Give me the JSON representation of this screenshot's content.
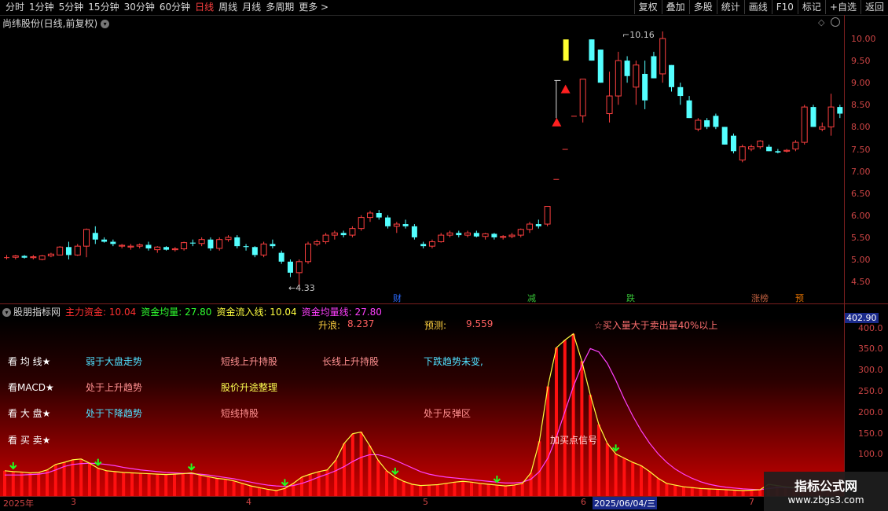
{
  "toolbar": {
    "periods": [
      "分时",
      "1分钟",
      "5分钟",
      "15分钟",
      "30分钟",
      "60分钟",
      "日线",
      "周线",
      "月线",
      "多周期",
      "更多 >"
    ],
    "active_period": "日线",
    "buttons": [
      "复权",
      "叠加",
      "多股",
      "统计",
      "画线",
      "F10",
      "标记",
      "+自选",
      "返回"
    ]
  },
  "stock": {
    "title": "尚纬股份(日线,前复权)"
  },
  "price_axis": [
    "10.00",
    "9.50",
    "9.00",
    "8.50",
    "8.00",
    "7.50",
    "7.00",
    "6.50",
    "6.00",
    "5.50",
    "5.00",
    "4.50"
  ],
  "price_annotations": {
    "high": "10.16",
    "low": "4.33"
  },
  "event_markers": [
    "财",
    "减",
    "跌",
    "涨榜",
    "预"
  ],
  "indicator": {
    "name": "股朋指标网",
    "fields": [
      {
        "label": "主力资金: 10.04",
        "color": "#ff3030"
      },
      {
        "label": "资金均量: 27.80",
        "color": "#30ff30"
      },
      {
        "label": "资金流入线: 10.04",
        "color": "#ffff40"
      },
      {
        "label": "资金均量线: 27.80",
        "color": "#ff40ff"
      }
    ],
    "current_value": "402.90",
    "axis": [
      "400.0",
      "350.0",
      "300.0",
      "250.0",
      "200.0",
      "150.0",
      "100.0"
    ]
  },
  "info": {
    "shenglang_label": "升浪:",
    "shenglang_value": "8.237",
    "yuce_label": "预测:",
    "yuce_value": "9.559",
    "buy_note": "☆买入量大于卖出量40%以上",
    "row_labels": [
      "看 均 线★",
      "看MACD★",
      "看 大 盘★",
      "看 买 卖★"
    ],
    "ma_row": [
      "弱于大盘走势",
      "短线上升持股",
      "长线上升持股",
      "下跌趋势未变,"
    ],
    "macd_row": [
      "处于上升趋势",
      "股价升途整理"
    ],
    "market_row": [
      "处于下降趋势",
      "短线持股",
      "处于反弹区"
    ],
    "signal": "加买点信号"
  },
  "dates": [
    "2025年",
    "3",
    "4",
    "5",
    "6",
    "7"
  ],
  "cursor_date": "2025/06/04/三",
  "watermark": {
    "title": "指标公式网",
    "url": "www.zbgs3.com"
  },
  "chart_data": {
    "type": "candlestick",
    "candles": [
      [
        5.05,
        5.1,
        5.0,
        5.05
      ],
      [
        5.05,
        5.1,
        5.0,
        5.08
      ],
      [
        5.08,
        5.1,
        5.02,
        5.04
      ],
      [
        5.04,
        5.1,
        5.0,
        5.06
      ],
      [
        5.0,
        5.1,
        4.98,
        5.08
      ],
      [
        5.08,
        5.15,
        5.05,
        5.12
      ],
      [
        5.1,
        5.3,
        5.1,
        5.28
      ],
      [
        5.28,
        5.4,
        5.0,
        5.1
      ],
      [
        5.1,
        5.35,
        5.08,
        5.3
      ],
      [
        5.3,
        5.7,
        5.05,
        5.68
      ],
      [
        5.6,
        5.75,
        5.35,
        5.45
      ],
      [
        5.45,
        5.5,
        5.38,
        5.4
      ],
      [
        5.4,
        5.45,
        5.3,
        5.35
      ],
      [
        5.3,
        5.35,
        5.25,
        5.32
      ],
      [
        5.28,
        5.35,
        5.22,
        5.3
      ],
      [
        5.3,
        5.36,
        5.25,
        5.33
      ],
      [
        5.33,
        5.4,
        5.2,
        5.25
      ],
      [
        5.22,
        5.3,
        5.15,
        5.28
      ],
      [
        5.28,
        5.3,
        5.2,
        5.22
      ],
      [
        5.22,
        5.28,
        5.18,
        5.24
      ],
      [
        5.24,
        5.4,
        5.2,
        5.38
      ],
      [
        5.38,
        5.45,
        5.3,
        5.36
      ],
      [
        5.36,
        5.5,
        5.3,
        5.45
      ],
      [
        5.45,
        5.5,
        5.2,
        5.25
      ],
      [
        5.25,
        5.5,
        5.2,
        5.45
      ],
      [
        5.45,
        5.55,
        5.4,
        5.5
      ],
      [
        5.5,
        5.55,
        5.25,
        5.3
      ],
      [
        5.3,
        5.35,
        5.2,
        5.28
      ],
      [
        5.28,
        5.3,
        5.05,
        5.1
      ],
      [
        5.1,
        5.4,
        5.05,
        5.35
      ],
      [
        5.35,
        5.45,
        5.25,
        5.3
      ],
      [
        5.15,
        5.2,
        4.9,
        4.95
      ],
      [
        4.95,
        5.0,
        4.6,
        4.7
      ],
      [
        4.7,
        5.0,
        4.33,
        4.95
      ],
      [
        4.95,
        5.4,
        4.9,
        5.35
      ],
      [
        5.35,
        5.45,
        5.3,
        5.4
      ],
      [
        5.4,
        5.6,
        5.35,
        5.55
      ],
      [
        5.55,
        5.65,
        5.45,
        5.6
      ],
      [
        5.6,
        5.65,
        5.5,
        5.55
      ],
      [
        5.55,
        5.75,
        5.5,
        5.7
      ],
      [
        5.7,
        6.0,
        5.65,
        5.95
      ],
      [
        5.95,
        6.1,
        5.85,
        6.05
      ],
      [
        6.05,
        6.12,
        5.9,
        5.95
      ],
      [
        5.95,
        6.0,
        5.7,
        5.75
      ],
      [
        5.75,
        5.85,
        5.6,
        5.8
      ],
      [
        5.8,
        5.9,
        5.7,
        5.75
      ],
      [
        5.75,
        5.8,
        5.45,
        5.5
      ],
      [
        5.35,
        5.4,
        5.25,
        5.3
      ],
      [
        5.3,
        5.45,
        5.25,
        5.4
      ],
      [
        5.4,
        5.6,
        5.38,
        5.55
      ],
      [
        5.55,
        5.65,
        5.5,
        5.6
      ],
      [
        5.6,
        5.65,
        5.5,
        5.55
      ],
      [
        5.55,
        5.65,
        5.5,
        5.6
      ],
      [
        5.6,
        5.65,
        5.5,
        5.52
      ],
      [
        5.52,
        5.6,
        5.45,
        5.58
      ],
      [
        5.58,
        5.6,
        5.45,
        5.5
      ],
      [
        5.5,
        5.55,
        5.45,
        5.52
      ],
      [
        5.52,
        5.6,
        5.48,
        5.55
      ],
      [
        5.55,
        5.7,
        5.5,
        5.68
      ],
      [
        5.68,
        5.85,
        5.6,
        5.8
      ],
      [
        5.8,
        5.9,
        5.7,
        5.75
      ],
      [
        5.8,
        6.2,
        5.75,
        6.2
      ],
      [
        6.82,
        6.82,
        6.82,
        6.82
      ],
      [
        7.5,
        7.5,
        7.5,
        7.5
      ],
      [
        8.25,
        8.25,
        8.25,
        8.25
      ],
      [
        8.25,
        9.08,
        8.1,
        9.08
      ],
      [
        9.98,
        9.98,
        9.5,
        9.5
      ],
      [
        9.75,
        9.75,
        9.0,
        9.0
      ],
      [
        8.3,
        9.25,
        8.1,
        8.7
      ],
      [
        8.7,
        9.7,
        8.5,
        9.5
      ],
      [
        9.5,
        9.6,
        9.0,
        9.15
      ],
      [
        8.9,
        9.5,
        8.5,
        9.4
      ],
      [
        9.2,
        9.5,
        8.4,
        8.6
      ],
      [
        9.6,
        9.7,
        9.1,
        9.1
      ],
      [
        9.2,
        10.16,
        9.0,
        10.0
      ],
      [
        9.4,
        9.4,
        8.8,
        8.9
      ],
      [
        8.9,
        9.0,
        8.5,
        8.7
      ],
      [
        8.6,
        8.7,
        8.2,
        8.2
      ],
      [
        7.95,
        8.2,
        7.9,
        8.15
      ],
      [
        8.15,
        8.2,
        7.95,
        8.0
      ],
      [
        8.25,
        8.3,
        7.95,
        8.0
      ],
      [
        8.0,
        8.0,
        7.6,
        7.6
      ],
      [
        7.8,
        7.85,
        7.4,
        7.45
      ],
      [
        7.25,
        7.6,
        7.2,
        7.55
      ],
      [
        7.5,
        7.6,
        7.45,
        7.55
      ],
      [
        7.55,
        7.7,
        7.5,
        7.68
      ],
      [
        7.55,
        7.6,
        7.45,
        7.45
      ],
      [
        7.45,
        7.5,
        7.4,
        7.42
      ],
      [
        7.45,
        7.5,
        7.42,
        7.47
      ],
      [
        7.5,
        7.7,
        7.45,
        7.65
      ],
      [
        7.65,
        8.5,
        7.6,
        8.45
      ],
      [
        8.45,
        8.5,
        8.0,
        8.0
      ],
      [
        7.95,
        8.1,
        7.9,
        8.0
      ],
      [
        8.0,
        8.75,
        7.8,
        8.45
      ],
      [
        8.45,
        8.5,
        8.2,
        8.3
      ],
      [
        8.3,
        8.35,
        8.0,
        8.05
      ],
      [
        8.0,
        8.05,
        7.75,
        7.8
      ],
      [
        7.9,
        8.05,
        7.8,
        8.02
      ]
    ],
    "indicator_bars": [
      60,
      58,
      57,
      55,
      56,
      62,
      75,
      80,
      86,
      88,
      78,
      66,
      60,
      58,
      56,
      55,
      54,
      53,
      52,
      51,
      52,
      53,
      55,
      50,
      46,
      42,
      40,
      36,
      30,
      24,
      20,
      16,
      13,
      18,
      30,
      45,
      52,
      58,
      62,
      85,
      125,
      148,
      152,
      120,
      85,
      60,
      45,
      35,
      28,
      25,
      26,
      27,
      30,
      33,
      35,
      33,
      30,
      28,
      26,
      24,
      26,
      30,
      55,
      130,
      260,
      352,
      370,
      385,
      320,
      240,
      170,
      125,
      100,
      90,
      80,
      72,
      58,
      42,
      30,
      26,
      22,
      20,
      18,
      17,
      16,
      15,
      14,
      13,
      14,
      15,
      28,
      25,
      22,
      20,
      18,
      16,
      15,
      14
    ],
    "ma_line": [
      50,
      50,
      50,
      51,
      52,
      55,
      62,
      70,
      75,
      77,
      78,
      77,
      75,
      72,
      68,
      65,
      62,
      60,
      58,
      56,
      55,
      54,
      53,
      52,
      50,
      47,
      44,
      41,
      37,
      33,
      29,
      26,
      24,
      23,
      25,
      30,
      37,
      45,
      52,
      60,
      70,
      82,
      92,
      98,
      98,
      93,
      85,
      76,
      67,
      58,
      52,
      48,
      45,
      43,
      41,
      39,
      37,
      35,
      33,
      31,
      31,
      33,
      40,
      58,
      90,
      140,
      200,
      260,
      310,
      350,
      342,
      315,
      275,
      230,
      190,
      155,
      125,
      100,
      80,
      64,
      52,
      42,
      34,
      28,
      24,
      21,
      19,
      17,
      16,
      15,
      18,
      20,
      20,
      19,
      18,
      17,
      16,
      15
    ],
    "buy_arrow_indices": [
      66,
      71,
      84,
      92
    ],
    "green_arrow_indices": [
      1,
      11,
      22,
      33,
      46,
      58,
      72
    ]
  }
}
